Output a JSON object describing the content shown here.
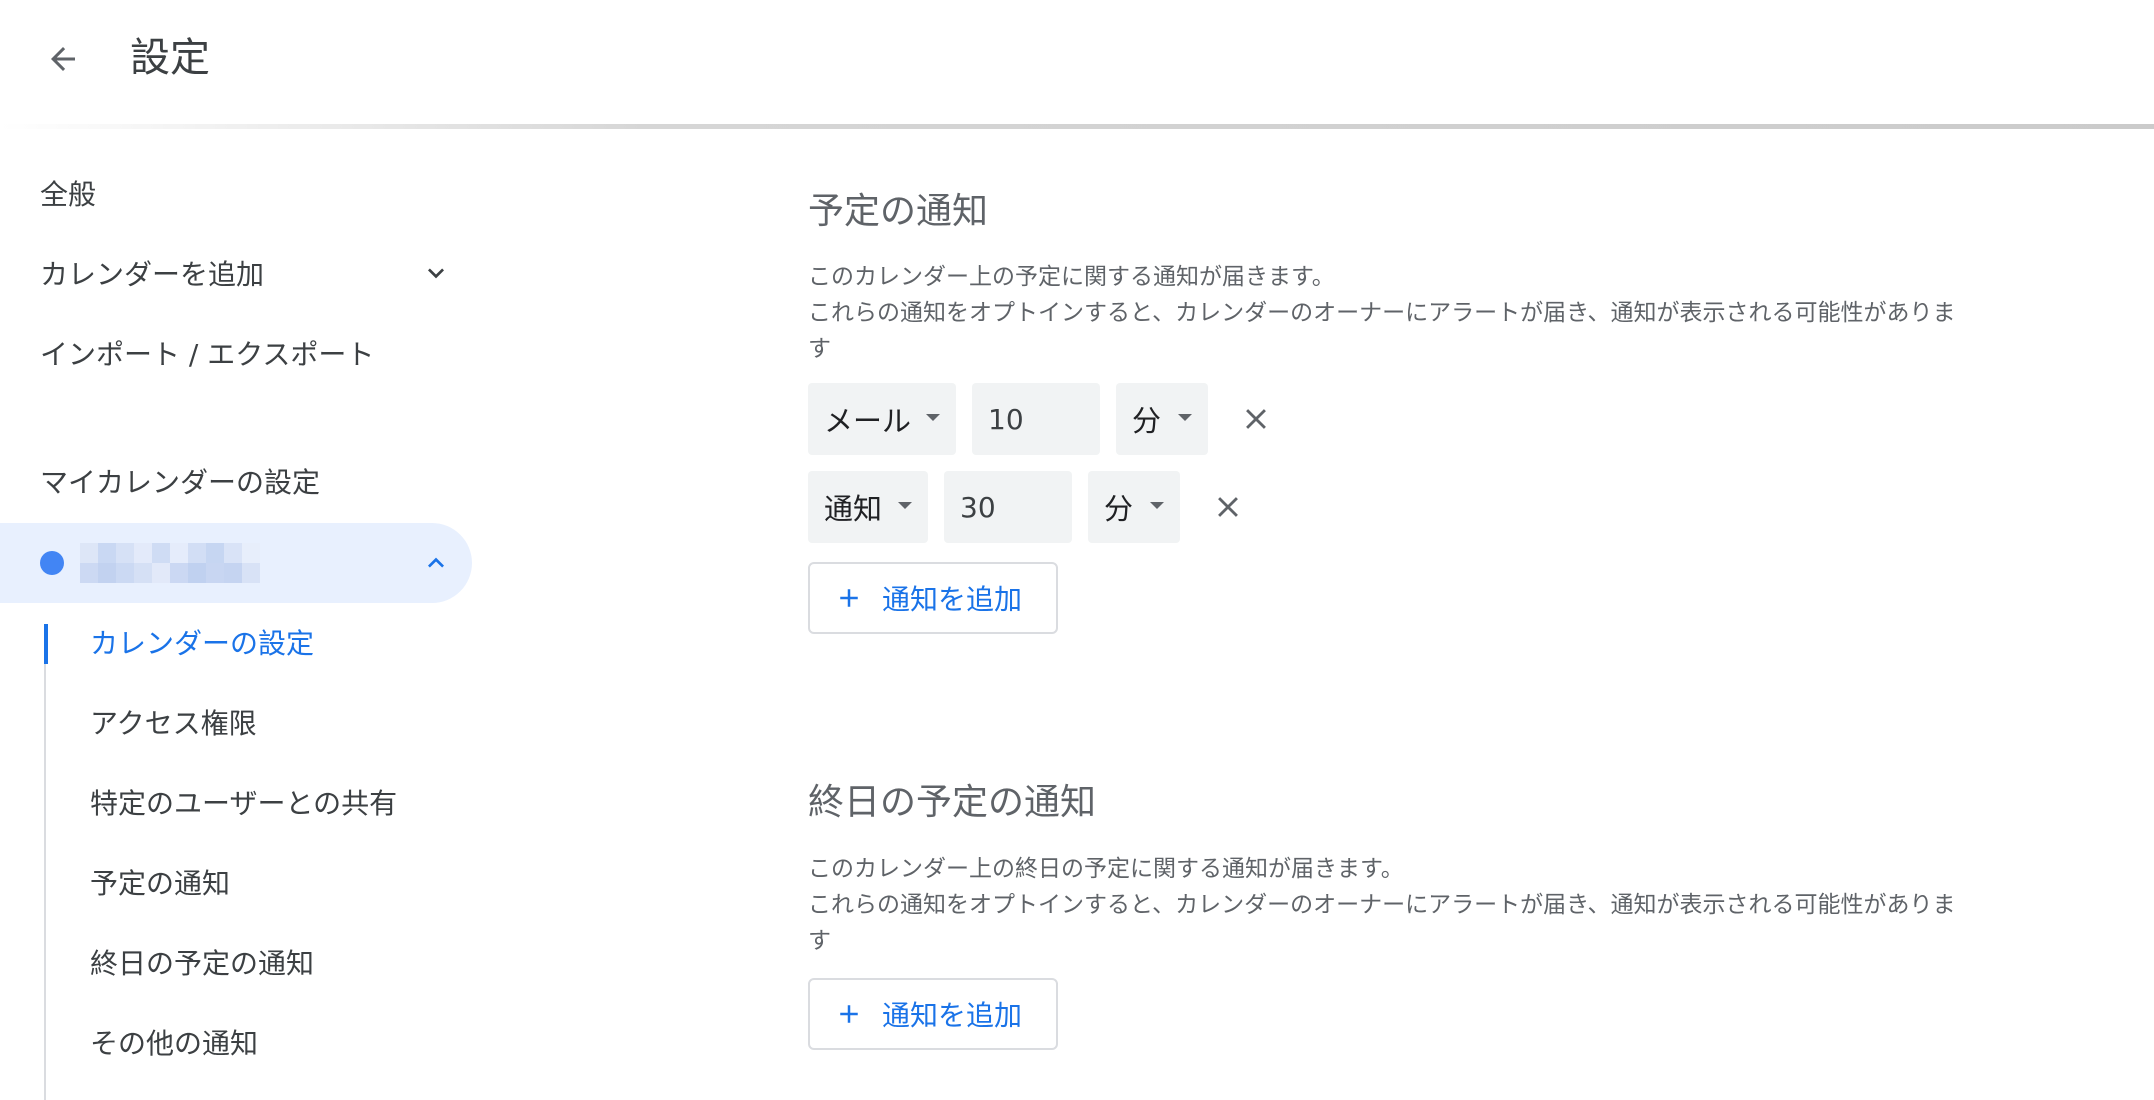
{
  "header": {
    "title": "設定"
  },
  "sidebar": {
    "items": [
      {
        "label": "全般"
      },
      {
        "label": "カレンダーを追加"
      },
      {
        "label": "インポート / エクスポート"
      }
    ],
    "section_header": "マイカレンダーの設定",
    "calendar": {
      "color": "#4285f4"
    },
    "subitems": [
      {
        "label": "カレンダーの設定",
        "active": true
      },
      {
        "label": "アクセス権限"
      },
      {
        "label": "特定のユーザーとの共有"
      },
      {
        "label": "予定の通知"
      },
      {
        "label": "終日の予定の通知"
      },
      {
        "label": "その他の通知"
      }
    ]
  },
  "event_notifications": {
    "title": "予定の通知",
    "desc_line1": "このカレンダー上の予定に関する通知が届きます。",
    "desc_line2": "これらの通知をオプトインすると、カレンダーのオーナーにアラートが届き、通知が表示される可能性がありま",
    "desc_line3": "す",
    "rows": [
      {
        "type": "メール",
        "amount": "10",
        "unit": "分"
      },
      {
        "type": "通知",
        "amount": "30",
        "unit": "分"
      }
    ],
    "add_label": "通知を追加"
  },
  "allday_notifications": {
    "title": "終日の予定の通知",
    "desc_line1": "このカレンダー上の終日の予定に関する通知が届きます。",
    "desc_line2": "これらの通知をオプトインすると、カレンダーのオーナーにアラートが届き、通知が表示される可能性がありま",
    "desc_line3": "す",
    "add_label": "通知を追加"
  },
  "colors": {
    "accent": "#1a73e8",
    "selected_bg": "#e8f0fe",
    "field_bg": "#f1f3f4"
  }
}
